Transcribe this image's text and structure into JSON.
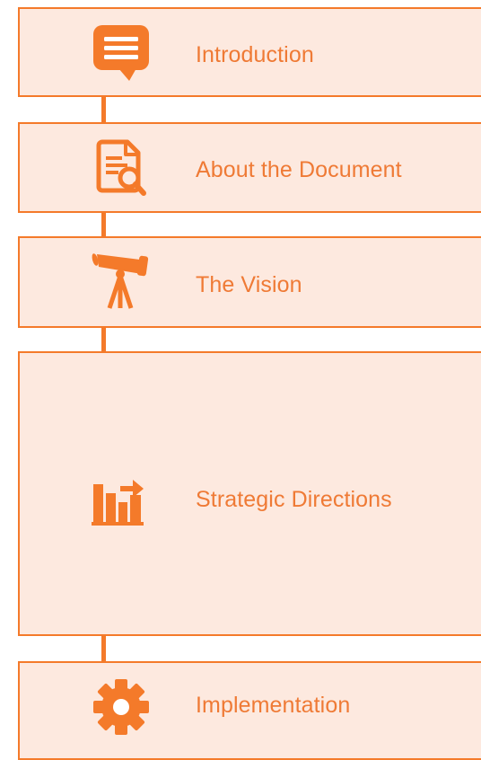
{
  "colors": {
    "accent": "#f47a2a",
    "box_fill": "#fde9df",
    "label_text": "#ef7a35"
  },
  "sections": [
    {
      "label": "Introduction",
      "icon": "speech-bubble-icon"
    },
    {
      "label": "About the Document",
      "icon": "document-search-icon"
    },
    {
      "label": "The Vision",
      "icon": "telescope-icon"
    },
    {
      "label": "Strategic Directions",
      "icon": "bar-chart-arrow-icon"
    },
    {
      "label": "Implementation",
      "icon": "gear-icon"
    }
  ]
}
